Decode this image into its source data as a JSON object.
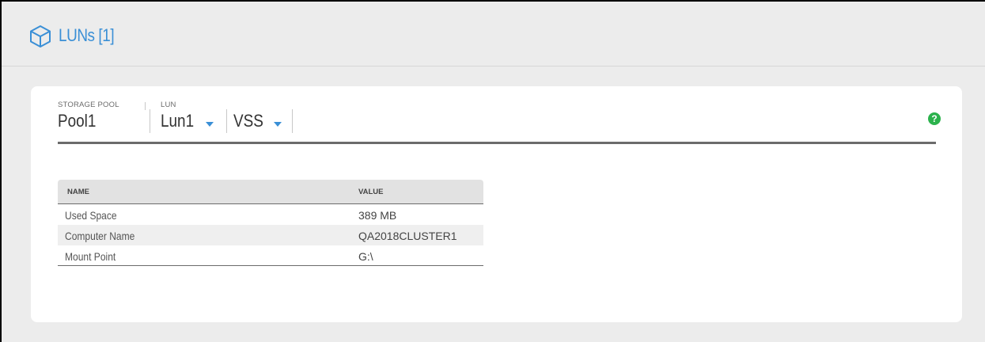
{
  "header": {
    "icon": "cube-icon",
    "title": "LUNs [1]"
  },
  "breadcrumb": {
    "storage_pool_label": "STORAGE POOL",
    "storage_pool_value": "Pool1",
    "lun_label": "LUN",
    "lun_value": "Lun1",
    "vss_value": "VSS"
  },
  "help": {
    "icon": "question-icon",
    "glyph": "?"
  },
  "table": {
    "columns": [
      "NAME",
      "VALUE"
    ],
    "rows": [
      {
        "name": "Used Space",
        "value": "389 MB"
      },
      {
        "name": "Computer Name",
        "value": "QA2018CLUSTER1"
      },
      {
        "name": "Mount Point",
        "value": "G:\\"
      }
    ]
  },
  "colors": {
    "accent": "#3a8fd6",
    "help": "#2bb24c",
    "background": "#ececec",
    "card": "#ffffff"
  }
}
